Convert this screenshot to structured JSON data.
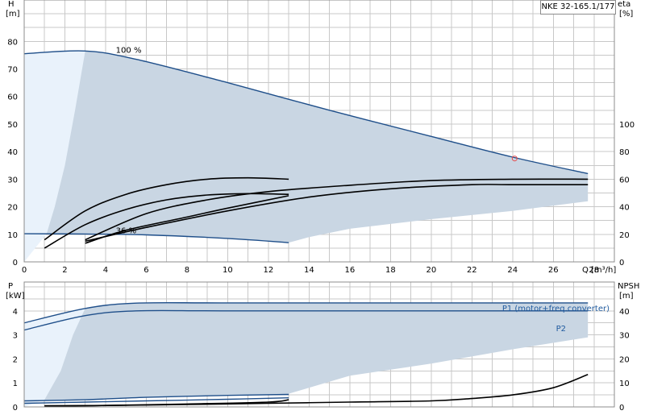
{
  "pump_label": "NKE 32-165.1/177",
  "chart_data": [
    {
      "type": "line",
      "panel": "upper",
      "xlabel": "Q",
      "xunit": "[m³/h]",
      "xlim": [
        0,
        29
      ],
      "x_ticks": [
        0,
        2,
        4,
        6,
        8,
        10,
        12,
        14,
        16,
        18,
        20,
        22,
        24,
        26,
        28
      ],
      "ylabel_left": "H",
      "yunit_left": "[m]",
      "ylim_left": [
        0,
        95
      ],
      "y_ticks_left": [
        0,
        10,
        20,
        30,
        40,
        50,
        60,
        70,
        80
      ],
      "ylabel_right": "eta",
      "yunit_right": "[%]",
      "ylim_right": [
        0,
        190
      ],
      "y_ticks_right": [
        0,
        20,
        40,
        60,
        80,
        100
      ],
      "grid": true,
      "annotations": [
        {
          "text": "100 %",
          "x": 4.9,
          "y": 77
        },
        {
          "text": "36 %",
          "x": 4.9,
          "y": 11.5
        }
      ],
      "operating_point": {
        "x": 24.1,
        "y": 37.5
      },
      "region": {
        "upper": [
          [
            0,
            75.5
          ],
          [
            3,
            76.5
          ],
          [
            5.5,
            73.5
          ],
          [
            10,
            65
          ],
          [
            15,
            55
          ],
          [
            20,
            45.5
          ],
          [
            24,
            38
          ],
          [
            27.7,
            32
          ]
        ],
        "right_low": [
          [
            27.7,
            22
          ],
          [
            24,
            18.5
          ],
          [
            20,
            15.5
          ],
          [
            16,
            12
          ],
          [
            14,
            9
          ],
          [
            13,
            7
          ]
        ],
        "lower": [
          [
            13,
            7
          ],
          [
            10,
            8.5
          ],
          [
            6,
            9.8
          ],
          [
            3,
            10.1
          ],
          [
            0,
            10.2
          ]
        ],
        "shade_boundary": [
          [
            0,
            0
          ],
          [
            1.1,
            10.2
          ],
          [
            1.5,
            20
          ],
          [
            2,
            35
          ],
          [
            2.5,
            55
          ],
          [
            3,
            76.5
          ]
        ]
      },
      "series": [
        {
          "name": "100 %",
          "axis": "H",
          "color": "#1f4f8a",
          "x": [
            0,
            3,
            5.5,
            10,
            15,
            20,
            24,
            27.7
          ],
          "y": [
            75.5,
            76.5,
            73.5,
            65,
            55,
            45.5,
            38,
            32
          ]
        },
        {
          "name": "36 %",
          "axis": "H",
          "color": "#1f4f8a",
          "x": [
            0,
            3,
            6,
            10,
            13
          ],
          "y": [
            10.2,
            10.1,
            9.8,
            8.5,
            7
          ]
        },
        {
          "axis": "H",
          "color": "#000000",
          "x": [
            3,
            6,
            9,
            12,
            16,
            20,
            24,
            27.7
          ],
          "y": [
            8,
            17.5,
            22.5,
            25.5,
            27.8,
            29.5,
            30,
            30
          ]
        },
        {
          "axis": "H",
          "color": "#000000",
          "x": [
            3,
            6,
            10,
            14,
            18,
            22,
            24,
            27.7
          ],
          "y": [
            7.5,
            12.5,
            18.5,
            23.5,
            26.5,
            28,
            28,
            28
          ]
        },
        {
          "axis": "eta",
          "color": "#000000",
          "x": [
            1,
            3,
            5,
            7,
            9,
            11,
            13
          ],
          "y": [
            16,
            37,
            49,
            56,
            60,
            61,
            60
          ]
        },
        {
          "axis": "eta",
          "color": "#000000",
          "x": [
            1,
            3,
            5,
            7,
            9,
            11,
            13
          ],
          "y": [
            10,
            27,
            38,
            45,
            48.5,
            49.5,
            49
          ]
        },
        {
          "axis": "eta",
          "color": "#000000",
          "x": [
            3,
            5,
            8,
            10,
            13
          ],
          "y": [
            13.5,
            23,
            32.5,
            39,
            48
          ]
        }
      ]
    },
    {
      "type": "line",
      "panel": "lower",
      "xlim": [
        0,
        29
      ],
      "ylabel_left": "P",
      "yunit_left": "[kW]",
      "ylim_left": [
        0,
        5.2
      ],
      "y_ticks_left": [
        0,
        1,
        2,
        3,
        4
      ],
      "ylabel_right": "NPSH",
      "yunit_right": "[m]",
      "ylim_right": [
        0,
        52
      ],
      "y_ticks_right": [
        0,
        10,
        20,
        30,
        40
      ],
      "grid": true,
      "region": {
        "upper": [
          [
            0,
            3.5
          ],
          [
            3,
            4.1
          ],
          [
            5.5,
            4.32
          ],
          [
            10,
            4.33
          ],
          [
            20,
            4.33
          ],
          [
            27.7,
            4.33
          ]
        ],
        "right_low": [
          [
            27.7,
            2.9
          ],
          [
            24,
            2.4
          ],
          [
            20,
            1.8
          ],
          [
            16,
            1.3
          ],
          [
            13,
            0.55
          ]
        ],
        "lower": [
          [
            13,
            0.5
          ],
          [
            10,
            0.48
          ],
          [
            6,
            0.4
          ],
          [
            3,
            0.3
          ],
          [
            0,
            0.25
          ]
        ],
        "shade_boundary": [
          [
            0,
            0
          ],
          [
            1,
            0.3
          ],
          [
            1.8,
            1.5
          ],
          [
            2.4,
            3
          ],
          [
            3,
            4.1
          ]
        ]
      },
      "series": [
        {
          "name": "P1 (motor+freq.converter)",
          "axis": "P",
          "color": "#1f4f8a",
          "x": [
            0,
            3,
            5.5,
            10,
            20,
            27.7
          ],
          "y": [
            3.5,
            4.1,
            4.32,
            4.33,
            4.33,
            4.33
          ]
        },
        {
          "name": "P2",
          "axis": "P",
          "color": "#1f4f8a",
          "x": [
            0,
            3,
            5.5,
            10,
            20,
            27.7
          ],
          "y": [
            3.2,
            3.8,
            4.0,
            4.0,
            4.0,
            4.0
          ]
        },
        {
          "axis": "P",
          "color": "#1f4f8a",
          "x": [
            0,
            3,
            6,
            10,
            13
          ],
          "y": [
            0.25,
            0.3,
            0.4,
            0.48,
            0.52
          ]
        },
        {
          "axis": "P",
          "color": "#1f4f8a",
          "x": [
            0,
            3,
            6,
            10,
            13
          ],
          "y": [
            0.15,
            0.2,
            0.25,
            0.32,
            0.38
          ]
        },
        {
          "axis": "NPSH",
          "color": "#000000",
          "x": [
            1,
            4,
            8,
            12,
            16,
            20,
            22,
            24,
            26,
            27.7
          ],
          "y": [
            0.5,
            0.6,
            1,
            1.5,
            2,
            2.5,
            3.5,
            5,
            8,
            13.5
          ]
        },
        {
          "axis": "NPSH",
          "color": "#000000",
          "x": [
            1,
            4,
            8,
            12,
            13
          ],
          "y": [
            0.3,
            0.6,
            1.2,
            2,
            3
          ]
        }
      ]
    }
  ]
}
